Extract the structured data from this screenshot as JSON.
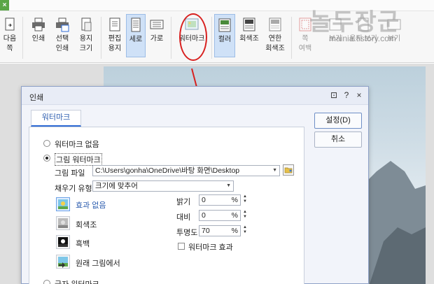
{
  "ribbon": {
    "items": [
      {
        "label": "다음\n쪽",
        "icon": "next-page-icon"
      },
      {
        "label": "인쇄",
        "icon": "printer-icon"
      },
      {
        "label": "선택\n인쇄",
        "icon": "select-print-icon"
      },
      {
        "label": "용지\n크기",
        "icon": "paper-size-icon"
      },
      {
        "label": "편집\n용지",
        "icon": "edit-paper-icon"
      },
      {
        "label": "세로",
        "icon": "portrait-icon"
      },
      {
        "label": "가로",
        "icon": "landscape-icon"
      },
      {
        "label": "워터마크",
        "icon": "watermark-icon"
      },
      {
        "label": "컬러",
        "icon": "color-icon"
      },
      {
        "label": "회색조",
        "icon": "grayscale-icon"
      },
      {
        "label": "연한\n회색조",
        "icon": "light-grayscale-icon"
      },
      {
        "label": "쪽\n여백",
        "icon": "margin-icon"
      },
      {
        "label": "보기",
        "icon": "view-icon"
      },
      {
        "label": "용지 보기",
        "icon": "paper-view-icon"
      },
      {
        "label": "보기",
        "icon": "view2-icon"
      }
    ]
  },
  "watermark_site": {
    "big": "놀두장군",
    "small": "mainia.tistory.com"
  },
  "dialog": {
    "title": "인쇄",
    "title_buttons": {
      "edit": "⊡",
      "help": "?",
      "close": "×"
    },
    "tab": "워터마크",
    "ok_button": "설정(D)",
    "cancel_button": "취소",
    "options": {
      "none": "워터마크 없음",
      "picture": "그림 워터마크",
      "text": "글자 워터마크"
    },
    "picture_file_label": "그림 파일",
    "picture_file_value": "C:\\Users\\gonha\\OneDrive\\바탕 화면\\Desktop",
    "fill_type_label": "채우기 유형",
    "fill_type_value": "크기에 맞추어",
    "effects": [
      {
        "label": "효과 없음",
        "icon": "no-effect-icon"
      },
      {
        "label": "회색조",
        "icon": "grayscale-effect-icon"
      },
      {
        "label": "흑백",
        "icon": "black-white-effect-icon"
      },
      {
        "label": "원래 그림에서",
        "icon": "original-picture-icon"
      }
    ],
    "brightness_label": "밝기",
    "brightness_value": "0",
    "contrast_label": "대비",
    "contrast_value": "0",
    "transparency_label": "투명도",
    "transparency_value": "70",
    "percent": "%",
    "watermark_effect_label": "워터마크 효과"
  },
  "colors": {
    "accent": "#2f6bd4",
    "annotation": "#d8201f"
  }
}
